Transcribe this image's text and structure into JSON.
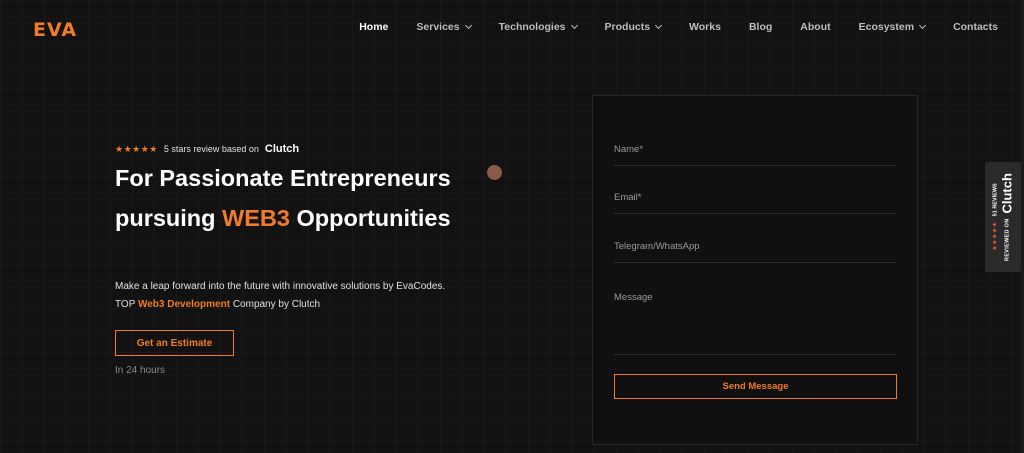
{
  "brand": {
    "logo_text": "EVA",
    "accent_color": "#f07b28"
  },
  "nav": {
    "items": [
      {
        "label": "Home",
        "dropdown": false,
        "active": true
      },
      {
        "label": "Services",
        "dropdown": true
      },
      {
        "label": "Technologies",
        "dropdown": true
      },
      {
        "label": "Products",
        "dropdown": true
      },
      {
        "label": "Works",
        "dropdown": false
      },
      {
        "label": "Blog",
        "dropdown": false
      },
      {
        "label": "About",
        "dropdown": false
      },
      {
        "label": "Ecosystem",
        "dropdown": true
      },
      {
        "label": "Contacts",
        "dropdown": false
      }
    ]
  },
  "hero": {
    "stars": "★★★★★",
    "review_text": "5 stars review based on",
    "review_brand": "Clutch",
    "title_line1": "For Passionate Entrepreneurs",
    "title_line2_prefix": "pursuing ",
    "title_line2_accent": "WEB3",
    "title_line2_suffix": " Opportunities",
    "desc_line1": "Make a leap forward into the future with innovative solutions by EvaCodes.",
    "desc_line2_prefix": "TOP ",
    "desc_line2_accent": "Web3 Development",
    "desc_line2_suffix": " Company by Clutch",
    "cta_label": "Get an Estimate",
    "cta_note": "In 24 hours"
  },
  "form": {
    "name_placeholder": "Name*",
    "email_placeholder": "Email*",
    "telegram_placeholder": "Telegram/WhatsApp",
    "message_placeholder": "Message",
    "submit_label": "Send Message"
  },
  "clutch_badge": {
    "reviewed_on": "REVIEWED ON",
    "stars": "★★★★★",
    "brand": "Clutch",
    "reviews": "51 REVIEWS"
  }
}
